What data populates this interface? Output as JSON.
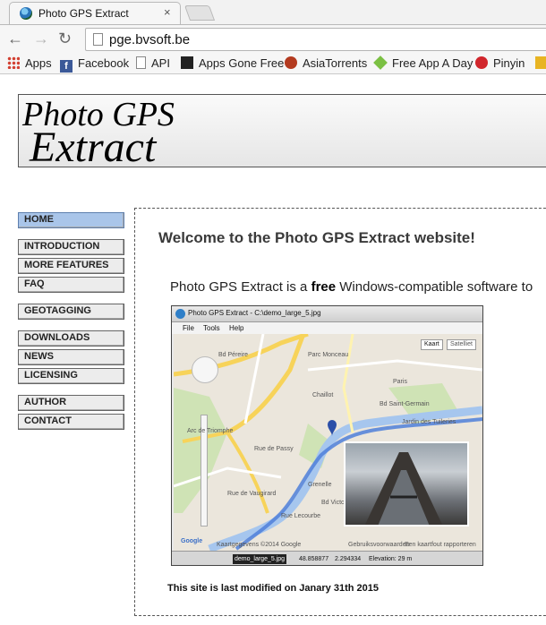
{
  "browser": {
    "tab_title": "Photo GPS Extract",
    "tab_close": "×",
    "url": "pge.bvsoft.be",
    "bookmarks": [
      {
        "label": "Apps",
        "icon": "apps-grid-icon",
        "color": "#d23f31"
      },
      {
        "label": "Facebook",
        "icon": "facebook-icon",
        "color": "#3b5998"
      },
      {
        "label": "API",
        "icon": "page-icon",
        "color": "#ffffff"
      },
      {
        "label": "Apps Gone Free",
        "icon": "agf-icon",
        "color": "#222222"
      },
      {
        "label": "AsiaTorrents",
        "icon": "asiatorrents-icon",
        "color": "#b33a1f"
      },
      {
        "label": "Free App A Day",
        "icon": "gem-icon",
        "color": "#7bc043"
      },
      {
        "label": "Pinyin",
        "icon": "pinyin-icon",
        "color": "#d1262c"
      }
    ]
  },
  "banner": {
    "line1": "Photo GPS",
    "line2": "Extract"
  },
  "menu": [
    {
      "label": "HOME",
      "active": true
    },
    {
      "label": "INTRODUCTION"
    },
    {
      "label": "MORE FEATURES"
    },
    {
      "label": "FAQ"
    },
    {
      "label": "GEOTAGGING"
    },
    {
      "label": "DOWNLOADS"
    },
    {
      "label": "NEWS"
    },
    {
      "label": "LICENSING"
    },
    {
      "label": "AUTHOR"
    },
    {
      "label": "CONTACT"
    }
  ],
  "content": {
    "welcome": "Welcome to the Photo GPS Extract website!",
    "intro_before": "Photo GPS Extract is a ",
    "intro_bold": "free",
    "intro_after": " Windows-compatible software to",
    "modified": "This site is last modified on Janary 31th 2015"
  },
  "screenshot": {
    "window_title": "Photo GPS Extract - C:\\demo_large_5.jpg",
    "menu_file": "File",
    "menu_tools": "Tools",
    "menu_help": "Help",
    "map_type_1": "Kaart",
    "map_type_2": "Satelliet",
    "labels": [
      "Bd Péreire",
      "Parc Monceau",
      "Arc de Triomphe",
      "Chaillot",
      "Bd Saint-Germain",
      "Jardin des Tuileries",
      "Rue de Passy",
      "Paris",
      "Grenelle",
      "Rue Lecourbe",
      "Bd Victor",
      "Rue de Vaugirard"
    ],
    "status_file": "demo_large_5.jpg",
    "status_lat": "48.858877",
    "status_lon": "2.294334",
    "status_elev": "Elevation: 29 m",
    "map_footer": "Kaartgegevens ©2014 Google",
    "map_terms": "Gebruiksvoorwaarden",
    "map_report": "Een kaartfout rapporteren",
    "google": "Google"
  },
  "colors": {
    "menu_active": "#a9c5e9",
    "menu_bg": "#ececec"
  }
}
